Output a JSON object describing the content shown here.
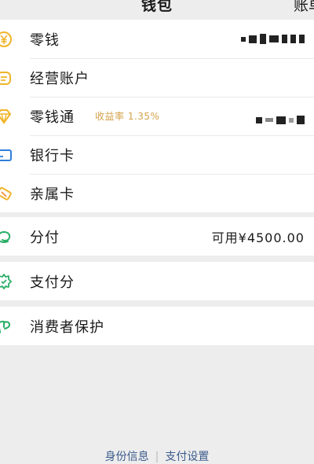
{
  "header": {
    "title": "钱包",
    "right_link": "账单"
  },
  "wallet_items": [
    {
      "label": "零钱",
      "icon": "yen-coin-icon",
      "value": "masked"
    },
    {
      "label": "经营账户",
      "icon": "merchant-account-icon"
    },
    {
      "label": "零钱通",
      "icon": "diamond-icon",
      "tag": "收益率 1.35%",
      "value": "masked"
    },
    {
      "label": "银行卡",
      "icon": "bank-card-icon"
    },
    {
      "label": "亲属卡",
      "icon": "family-card-icon"
    }
  ],
  "installment": {
    "label": "分付",
    "icon": "installment-icon",
    "value": "可用¥4500.00"
  },
  "pay_score": {
    "label": "支付分",
    "icon": "pay-score-icon"
  },
  "consumer_protection": {
    "label": "消费者保护",
    "icon": "shield-hand-icon"
  },
  "footer": {
    "identity": "身份信息",
    "settings": "支付设置"
  },
  "colors": {
    "accent": "#f0b429",
    "icon_green": "#2aae67",
    "icon_blue": "#2f7fd8",
    "tag": "#d4a24a",
    "link": "#3b5b8c",
    "background": "#ededed"
  }
}
